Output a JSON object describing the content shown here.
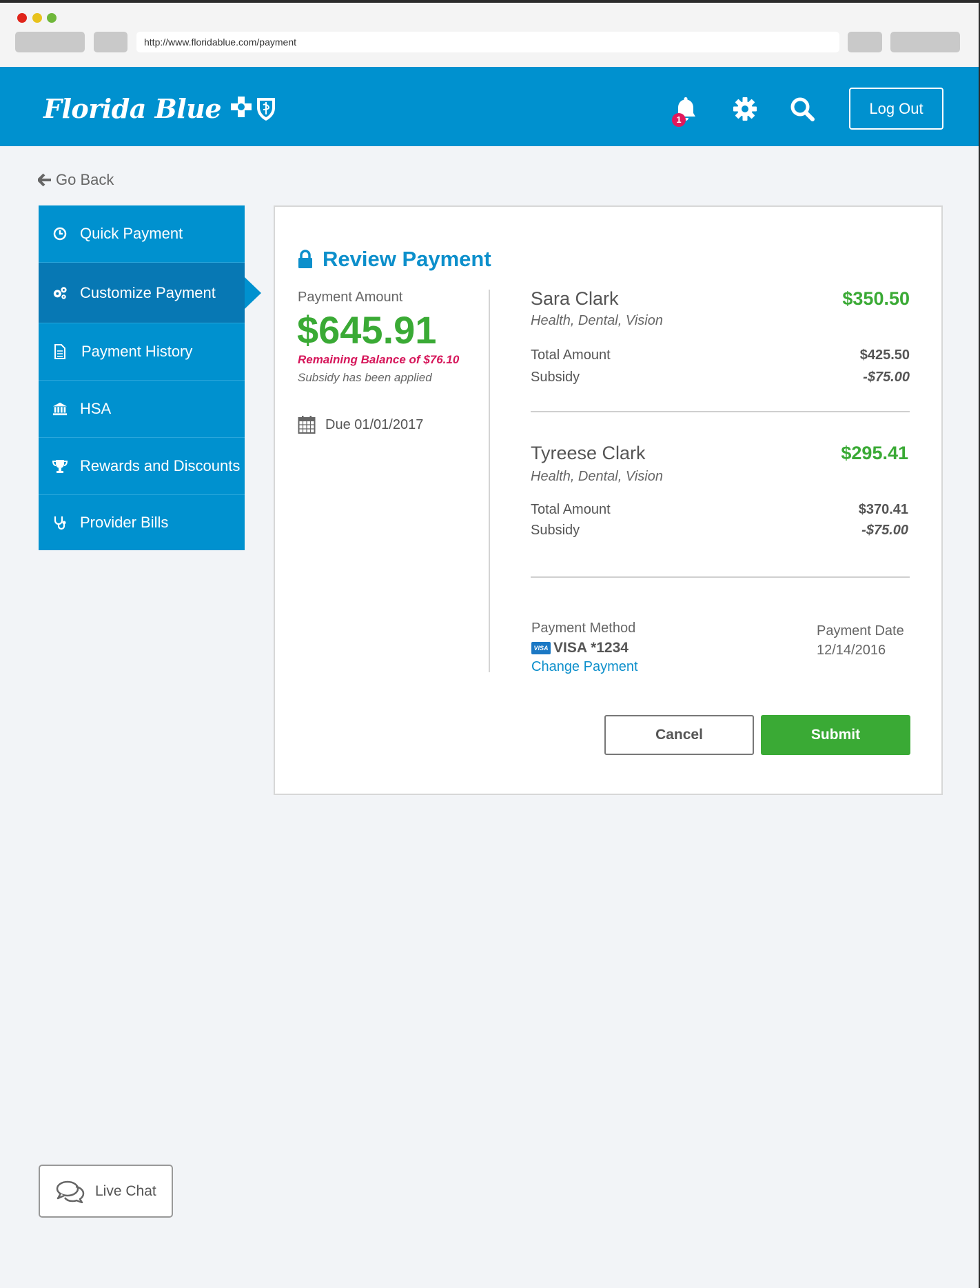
{
  "browser": {
    "url": "http://www.floridablue.com/payment"
  },
  "header": {
    "logo_text": "Florida Blue",
    "notification_count": "1",
    "logout_label": "Log Out"
  },
  "nav": {
    "go_back": "Go Back",
    "items": [
      {
        "label": "Quick Payment",
        "icon": "clock-icon"
      },
      {
        "label": "Customize Payment",
        "icon": "gears-icon"
      },
      {
        "label": "Payment History",
        "icon": "document-icon"
      },
      {
        "label": "HSA",
        "icon": "bank-icon"
      },
      {
        "label": "Rewards and Discounts",
        "icon": "trophy-icon"
      },
      {
        "label": "Provider Bills",
        "icon": "stethoscope-icon"
      }
    ]
  },
  "review": {
    "title": "Review Payment",
    "payment_amount_label": "Payment Amount",
    "payment_amount": "$645.91",
    "remaining_balance": "Remaining Balance of $76.10",
    "subsidy_note": "Subsidy has been applied",
    "due": "Due 01/01/2017",
    "members": [
      {
        "name": "Sara Clark",
        "amount": "$350.50",
        "plan": "Health, Dental, Vision",
        "total_label": "Total Amount",
        "total_value": "$425.50",
        "subsidy_label": "Subsidy",
        "subsidy_value": "-$75.00"
      },
      {
        "name": "Tyreese Clark",
        "amount": "$295.41",
        "plan": "Health, Dental, Vision",
        "total_label": "Total Amount",
        "total_value": "$370.41",
        "subsidy_label": "Subsidy",
        "subsidy_value": "-$75.00"
      }
    ],
    "payment_method_label": "Payment Method",
    "card_brand": "VISA",
    "payment_method": "VISA *1234",
    "change_payment": "Change Payment",
    "payment_date_label": "Payment Date",
    "payment_date": "12/14/2016",
    "cancel_label": "Cancel",
    "submit_label": "Submit"
  },
  "chat": {
    "label": "Live Chat"
  },
  "colors": {
    "brand_blue": "#0091cf",
    "active_blue": "#0778b4",
    "green": "#3aaa35",
    "alert_pink": "#d6165a"
  }
}
